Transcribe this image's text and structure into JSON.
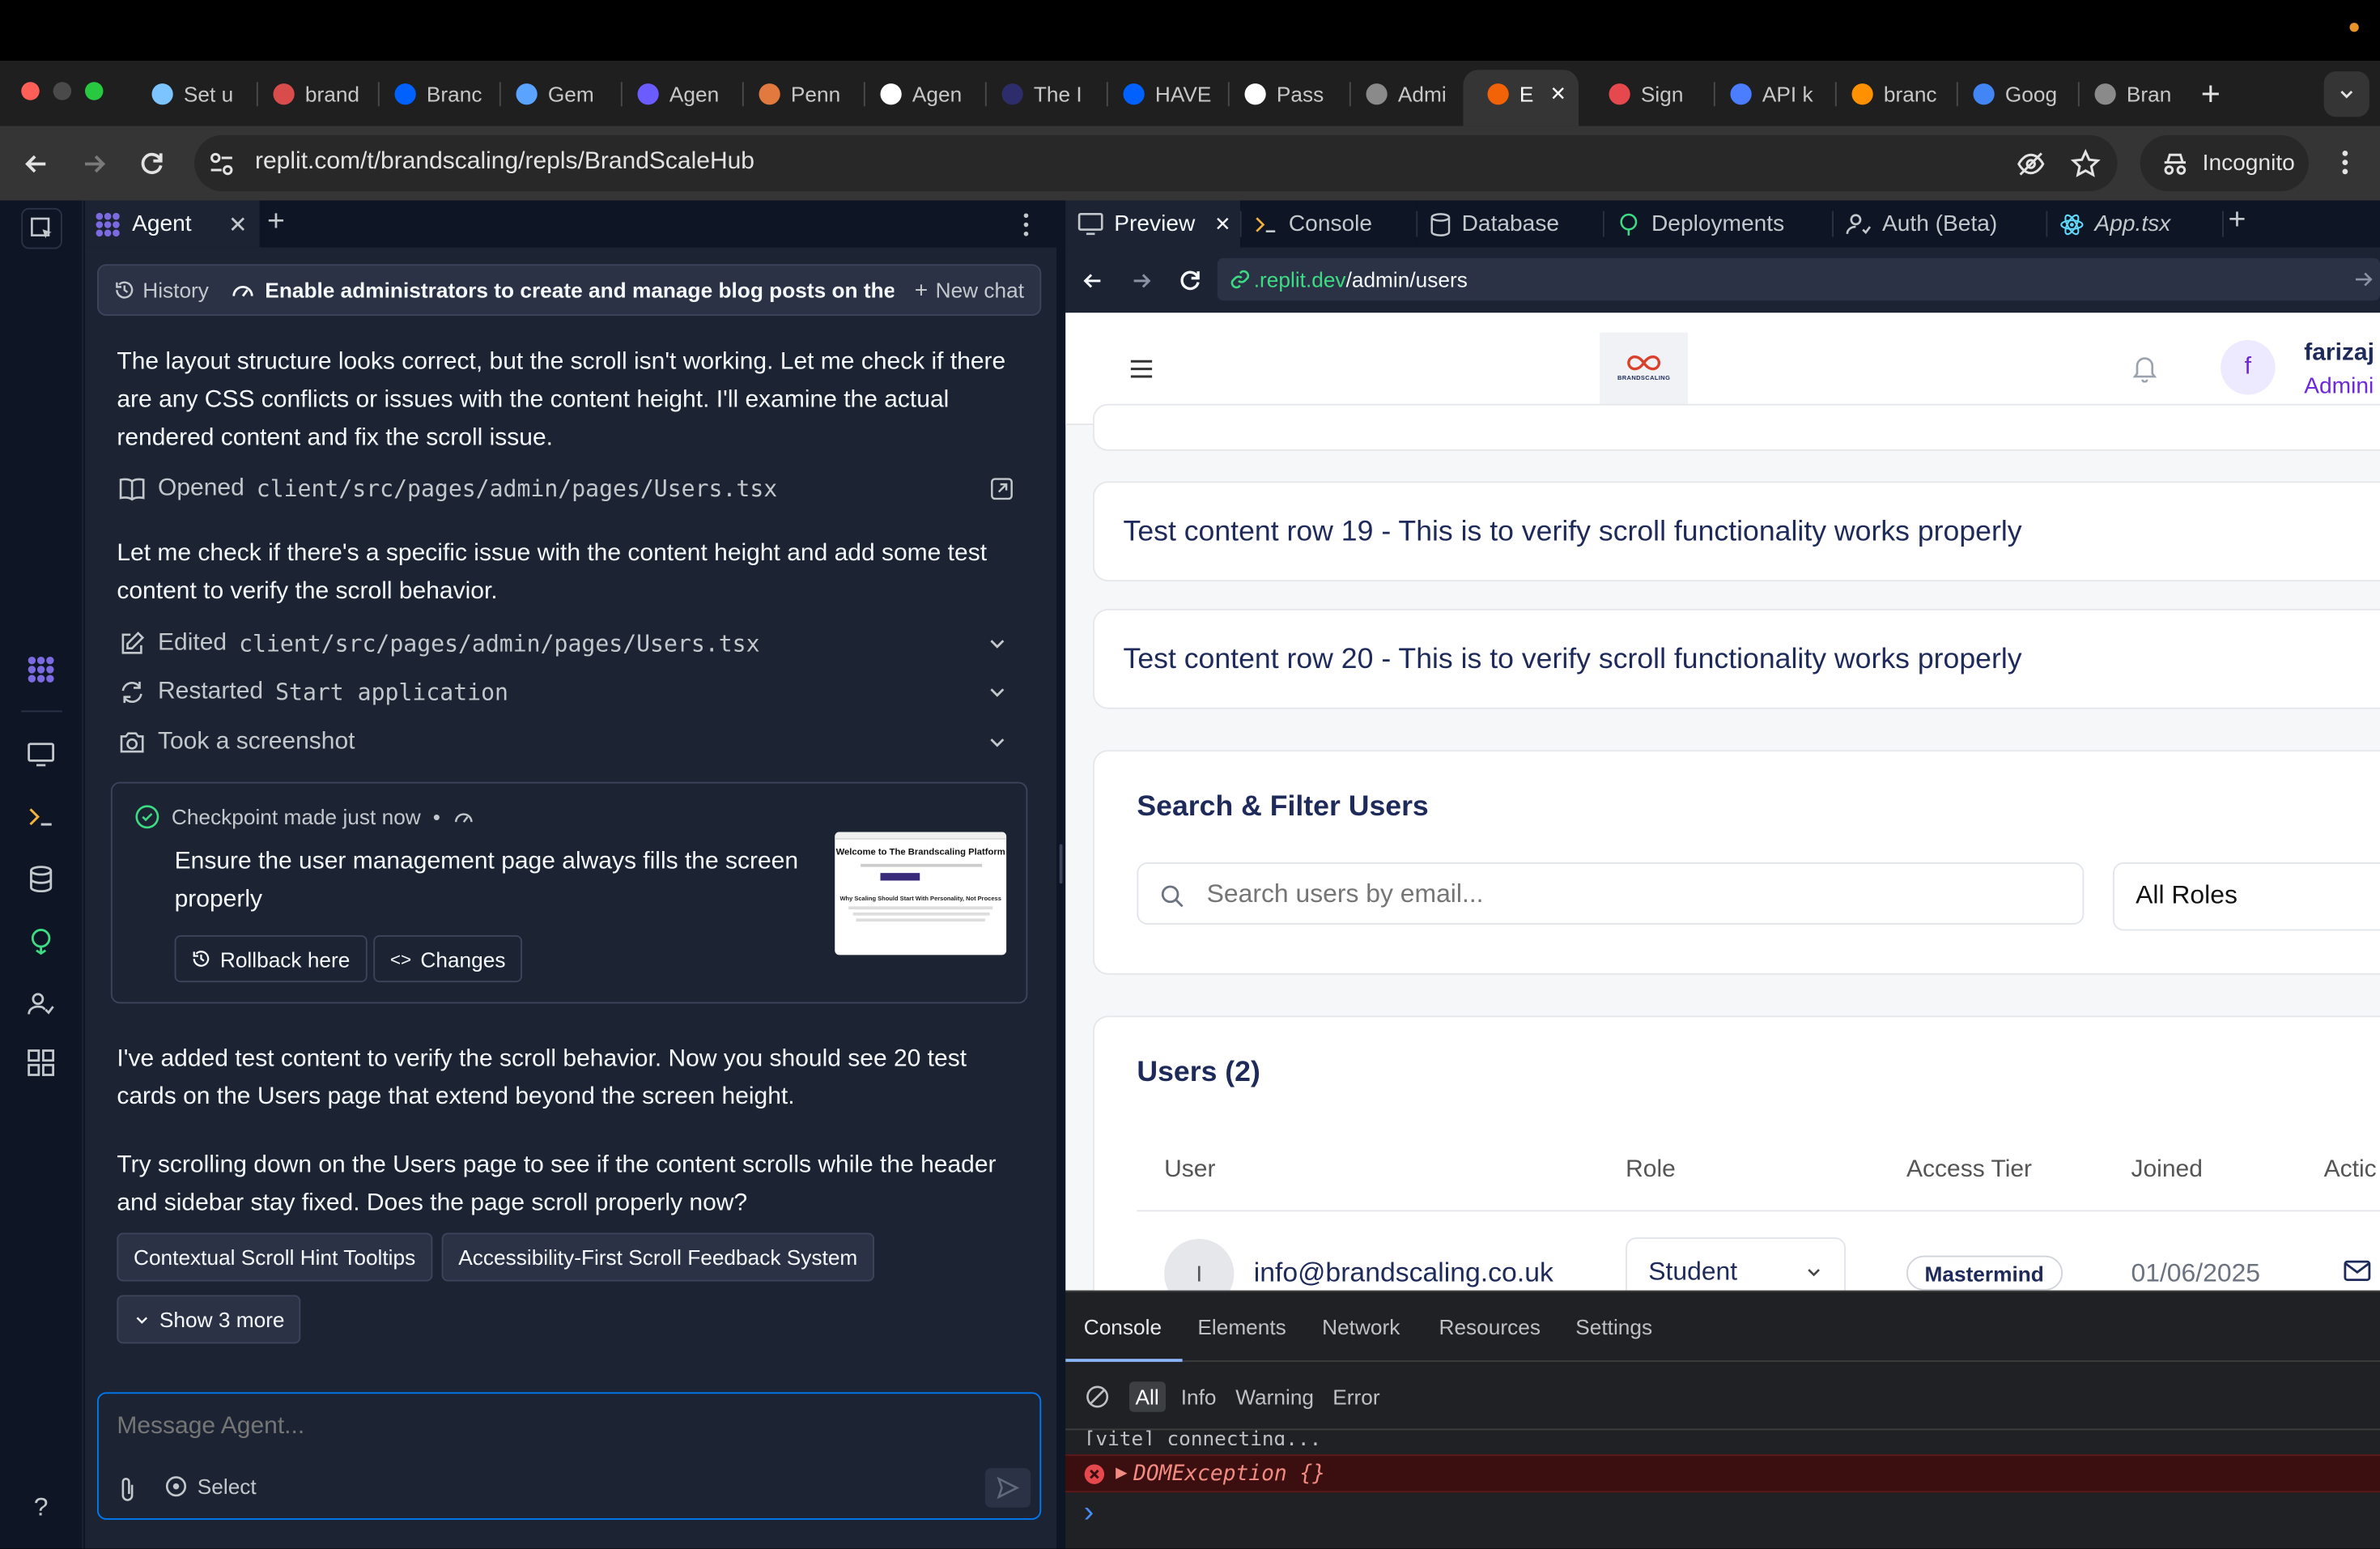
{
  "browser": {
    "tabs": [
      {
        "label": "Set u",
        "icon": "replit-spiral-icon",
        "color": "#7cc4ff"
      },
      {
        "label": "brand",
        "icon": "doc-icon",
        "color": "#d94c4c"
      },
      {
        "label": "Branc",
        "icon": "dropbox-icon",
        "color": "#0061fe"
      },
      {
        "label": "Gem",
        "icon": "gemini-icon",
        "color": "#5aa3ff"
      },
      {
        "label": "Agen",
        "icon": "agent-icon",
        "color": "#6a5cff"
      },
      {
        "label": "Penn",
        "icon": "pen-icon",
        "color": "#e27a3f"
      },
      {
        "label": "Agen",
        "icon": "triangle-icon",
        "color": "#ffffff"
      },
      {
        "label": "The I",
        "icon": "circle-icon",
        "color": "#2d2d6b"
      },
      {
        "label": "HAVE",
        "icon": "dropbox-icon",
        "color": "#0061fe"
      },
      {
        "label": "Pass",
        "icon": "upwork-icon",
        "color": "#ffffff"
      },
      {
        "label": "Admi",
        "icon": "globe-icon",
        "color": "#8a8a8a"
      },
      {
        "label": "E",
        "icon": "replit-icon",
        "color": "#f26207",
        "active": true
      },
      {
        "label": "Sign",
        "icon": "fire-icon",
        "color": "#e5484d"
      },
      {
        "label": "API k",
        "icon": "openai-icon",
        "color": "#4a7dff"
      },
      {
        "label": "branc",
        "icon": "flame-icon",
        "color": "#ff9100"
      },
      {
        "label": "Goog",
        "icon": "google-icon",
        "color": "#4285f4"
      },
      {
        "label": "Bran",
        "icon": "globe-icon",
        "color": "#8a8a8a"
      }
    ],
    "url": "replit.com/t/brandscaling/repls/BrandScaleHub",
    "incognito_label": "Incognito"
  },
  "agent": {
    "tab_label": "Agent",
    "history_label": "History",
    "thread_title": "Enable administrators to create and manage blog posts on the pl...",
    "new_chat_label": "New chat",
    "messages": {
      "m1": "The layout structure looks correct, but the scroll isn't working. Let me check if there are any CSS conflicts or issues with the content height. I'll examine the actual rendered content and fix the scroll issue.",
      "opened_prefix": "Opened",
      "opened_file": "client/src/pages/admin/pages/Users.tsx",
      "m2": "Let me check if there's a specific issue with the content height and add some test content to verify the scroll behavior.",
      "edited_prefix": "Edited",
      "edited_file": "client/src/pages/admin/pages/Users.tsx",
      "restarted_prefix": "Restarted",
      "restarted_target": "Start application",
      "screenshot_label": "Took a screenshot",
      "m3": "I've added test content to verify the scroll behavior. Now you should see 20 test cards on the Users page that extend beyond the screen height.",
      "m4": "Try scrolling down on the Users page to see if the content scrolls while the header and sidebar stay fixed. Does the page scroll properly now?"
    },
    "checkpoint": {
      "status": "Checkpoint made just now",
      "dot": "•",
      "description": "Ensure the user management page always fills the screen properly",
      "rollback_label": "Rollback here",
      "changes_label": "Changes",
      "thumb_title": "Welcome to The Brandscaling Platform",
      "thumb_subtitle": "Why Scaling Should Start With Personality, Not Process"
    },
    "suggestions": [
      "Contextual Scroll Hint Tooltips",
      "Accessibility-First Scroll Feedback System"
    ],
    "show_more_label": "Show 3 more",
    "composer_placeholder": "Message Agent...",
    "select_label": "Select"
  },
  "workspace": {
    "tabs": [
      {
        "label": "Preview",
        "icon": "monitor-icon"
      },
      {
        "label": "Console",
        "icon": "terminal-icon"
      },
      {
        "label": "Database",
        "icon": "database-icon"
      },
      {
        "label": "Deployments",
        "icon": "deploy-icon"
      },
      {
        "label": "Auth (Beta)",
        "icon": "user-check-icon"
      },
      {
        "label": "App.tsx",
        "icon": "react-icon"
      }
    ],
    "preview_url_host": ".replit.dev",
    "preview_url_path": "/admin/users"
  },
  "site": {
    "logo_text": "BRANDSCALING",
    "avatar_initial": "f",
    "user_name": "farizaj",
    "user_role": "Admini",
    "rows": [
      "Test content row 19 - This is to verify scroll functionality works properly",
      "Test content row 20 - This is to verify scroll functionality works properly"
    ],
    "search_title": "Search & Filter Users",
    "search_placeholder": "Search users by email...",
    "roles_filter": "All Roles",
    "users_title": "Users (2)",
    "table_headers": [
      "User",
      "Role",
      "Access Tier",
      "Joined",
      "Actic"
    ],
    "user_row": {
      "initial": "I",
      "email": "info@brandscaling.co.uk",
      "role": "Student",
      "tier": "Mastermind",
      "joined": "01/06/2025"
    }
  },
  "devtools": {
    "tabs": [
      "Console",
      "Elements",
      "Network",
      "Resources",
      "Settings"
    ],
    "levels": [
      "All",
      "Info",
      "Warning",
      "Error"
    ],
    "log_line": "[vite] connecting...",
    "error_text": "DOMException {}",
    "prompt": "›"
  },
  "colors": {
    "accent": "#0079f2",
    "agent_purple": "#7c6ae0",
    "navy": "#1e2a5a",
    "error_bg": "#3b0f10",
    "error_text": "#f28b82"
  }
}
